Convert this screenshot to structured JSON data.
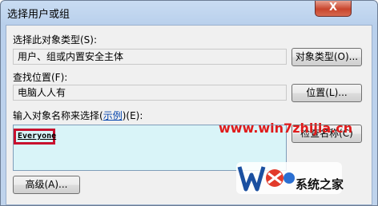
{
  "window": {
    "title": "选择用户或组",
    "close_glyph": "X"
  },
  "object_types": {
    "label": "选择此对象类型(S):",
    "value": "用户、组或内置安全主体",
    "button": "对象类型(O)..."
  },
  "location": {
    "label": "查找位置(F):",
    "value": "电脑人人有",
    "button": "位置(L)..."
  },
  "object_names": {
    "label_prefix": "输入对象名称来选择(",
    "examples_link": "示例",
    "label_suffix": ")(E):",
    "entered_name": "Everyone",
    "check_names_button": "检查名称(C)"
  },
  "advanced_button": "高级(A)...",
  "watermark": {
    "url": "www.win7zhijia.cn",
    "text": "系统之家"
  }
}
